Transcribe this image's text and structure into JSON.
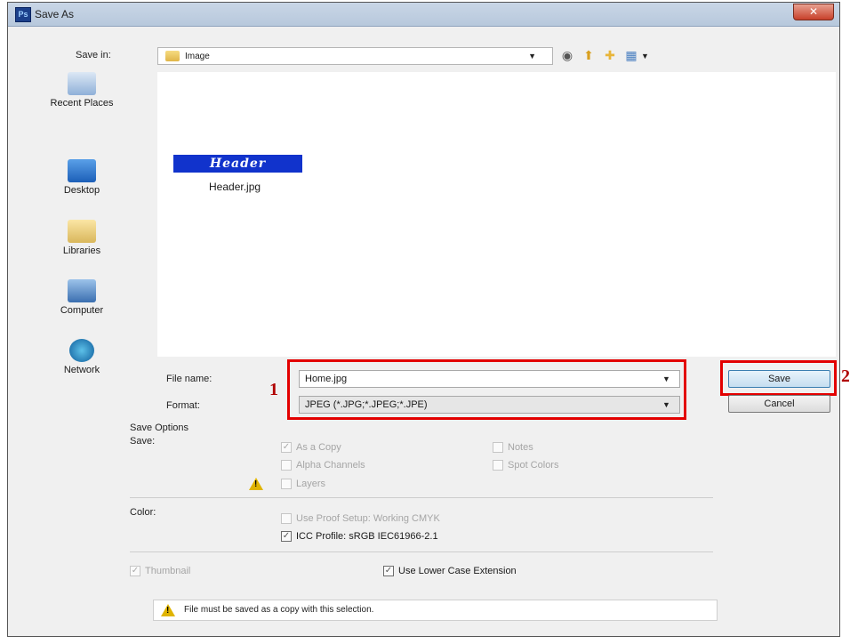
{
  "window": {
    "title": "Save As",
    "app_badge": "Ps",
    "close_glyph": "✕"
  },
  "save_in": {
    "label": "Save in:",
    "value": "Image"
  },
  "places": [
    {
      "label": "Recent Places",
      "icon": "recent-places-icon"
    },
    {
      "label": "Desktop",
      "icon": "desktop-icon"
    },
    {
      "label": "Libraries",
      "icon": "libraries-icon"
    },
    {
      "label": "Computer",
      "icon": "computer-icon"
    },
    {
      "label": "Network",
      "icon": "network-icon"
    }
  ],
  "files": [
    {
      "thumbnail_text": "Header",
      "name": "Header.jpg"
    }
  ],
  "file_name": {
    "label": "File name:",
    "value": "Home.jpg"
  },
  "format": {
    "label": "Format:",
    "value": "JPEG (*.JPG;*.JPEG;*.JPE)"
  },
  "buttons": {
    "save": "Save",
    "cancel": "Cancel"
  },
  "annotations": {
    "marker_1": "1",
    "marker_2": "2"
  },
  "save_options": {
    "heading": "Save Options",
    "save_label": "Save:",
    "as_a_copy": "As a Copy",
    "notes": "Notes",
    "alpha_channels": "Alpha Channels",
    "spot_colors": "Spot Colors",
    "layers": "Layers"
  },
  "color": {
    "label": "Color:",
    "use_proof_setup": "Use Proof Setup:  Working CMYK",
    "icc_profile": "ICC Profile:  sRGB IEC61966-2.1"
  },
  "thumbnail": "Thumbnail",
  "lower_case_ext": "Use Lower Case Extension",
  "message": "File must be saved as a copy with this selection.",
  "colors": {
    "highlight_box": "#e30000",
    "thumbnail_bg": "#1133cc"
  }
}
